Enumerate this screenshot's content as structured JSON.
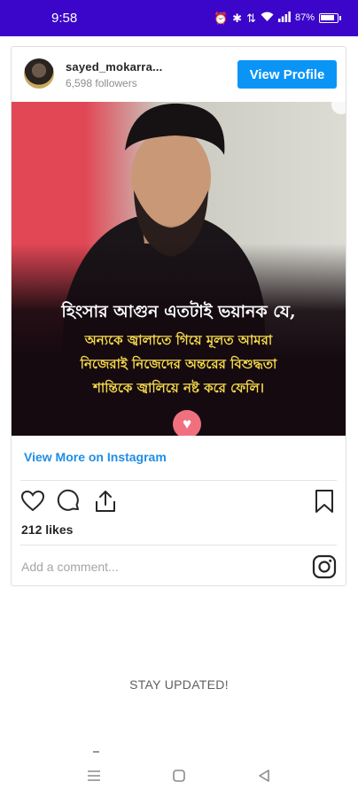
{
  "status_bar": {
    "time": "9:58",
    "battery": "87%",
    "battery_level": 0.87,
    "background": "#3b06c9"
  },
  "post": {
    "username": "sayed_mokarra...",
    "followers": "6,598 followers",
    "view_profile_label": "View Profile",
    "accent": "#0a95f6",
    "image_quote": {
      "line1": "হিংসার আগুন এতটাই ভয়ানক যে,",
      "line2": "অন্যকে জ্বালাতে গিয়ে মূলত আমরা",
      "line3": "নিজেরাই নিজেদের অন্তরের বিশুদ্ধতা",
      "line4": "শান্তিকে জ্বালিয়ে নষ্ট করে ফেলি।"
    },
    "view_more_label": "View More on Instagram",
    "likes": "212 likes",
    "comment_placeholder": "Add a comment..."
  },
  "footer": {
    "stay_updated": "STAY UPDATED!"
  },
  "icons": [
    "wifi-icon",
    "signal-icon",
    "alarm-icon",
    "bluetooth-icon",
    "heart-icon",
    "comment-icon",
    "share-icon",
    "bookmark-icon",
    "instagram-icon",
    "nav-recents-icon",
    "nav-home-icon",
    "nav-back-icon"
  ]
}
